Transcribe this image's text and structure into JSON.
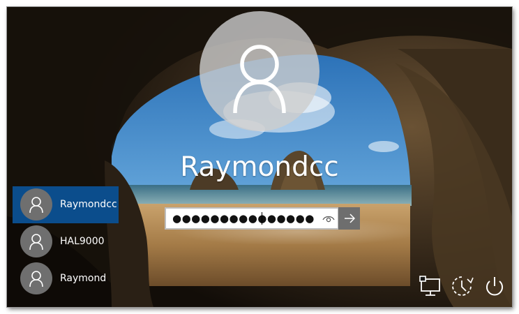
{
  "login": {
    "username": "Raymondcc",
    "password_masked": "●●●●●●●●●●●●●●●"
  },
  "users": [
    {
      "name": "Raymondcc",
      "selected": true
    },
    {
      "name": "HAL9000",
      "selected": false
    },
    {
      "name": "Raymond",
      "selected": false
    }
  ],
  "icons": {
    "avatar": "user-silhouette-icon",
    "reveal": "eye-icon",
    "submit": "arrow-right-icon",
    "network": "network-icon",
    "accessibility": "ease-of-access-icon",
    "power": "power-icon"
  },
  "colors": {
    "selected_user": "#0b4d8c",
    "submit_button": "#6e6e6e",
    "avatar_circle": "#cdcdcd",
    "text": "#ffffff"
  }
}
